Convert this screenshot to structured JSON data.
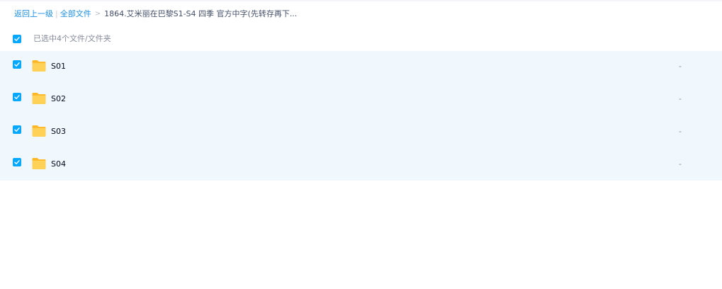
{
  "breadcrumb": {
    "back_label": "返回上一级",
    "all_files_label": "全部文件",
    "separator_bar": "|",
    "separator_gt": ">",
    "current_folder": "1864.艾米丽在巴黎S1-S4 四季 官方中字(先转存再下..."
  },
  "selection": {
    "summary": "已选中4个文件/文件夹",
    "all_checked": true
  },
  "files": [
    {
      "name": "S01",
      "size": "-",
      "type": "folder-icon",
      "checked": true
    },
    {
      "name": "S02",
      "size": "-",
      "type": "folder-icon",
      "checked": true
    },
    {
      "name": "S03",
      "size": "-",
      "type": "folder-icon",
      "checked": true
    },
    {
      "name": "S04",
      "size": "-",
      "type": "folder-icon",
      "checked": true
    }
  ],
  "colors": {
    "accent": "#06a7ff",
    "link": "#1e8fe1",
    "selected_row_bg": "#f0f7fd",
    "folder_yellow": "#ffc93c"
  }
}
